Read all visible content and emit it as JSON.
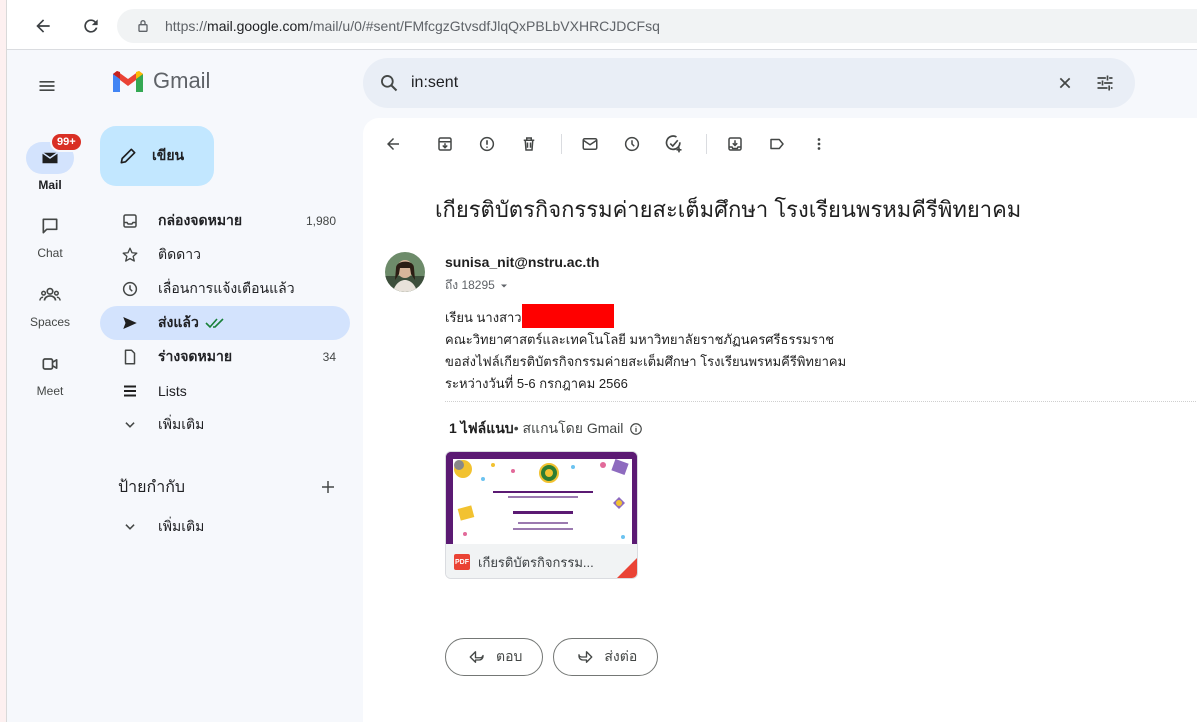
{
  "browser": {
    "url_prefix": "https://",
    "url_host": "mail.google.com",
    "url_path": "/mail/u/0/#sent/FMfcgzGtvsdfJlqQxPBLbVXHRCJDCFsq"
  },
  "app": {
    "name": "Gmail"
  },
  "search": {
    "query": "in:sent"
  },
  "rail": {
    "mail": {
      "label": "Mail",
      "badge": "99+"
    },
    "chat": {
      "label": "Chat"
    },
    "spaces": {
      "label": "Spaces"
    },
    "meet": {
      "label": "Meet"
    }
  },
  "compose": {
    "label": "เขียน"
  },
  "nav": {
    "inbox": {
      "label": "กล่องจดหมาย",
      "count": "1,980"
    },
    "starred": {
      "label": "ติดดาว"
    },
    "snoozed": {
      "label": "เลื่อนการแจ้งเตือนแล้ว"
    },
    "sent": {
      "label": "ส่งแล้ว"
    },
    "drafts": {
      "label": "ร่างจดหมาย",
      "count": "34"
    },
    "lists": {
      "label": "Lists"
    },
    "more": {
      "label": "เพิ่มเติม"
    }
  },
  "labels": {
    "title": "ป้ายกำกับ",
    "more": "เพิ่มเติม"
  },
  "message": {
    "subject": "เกียรติบัตรกิจกรรมค่ายสะเต็มศึกษา โรงเรียนพรหมคีรีพิทยาคม",
    "sender": "sunisa_nit@nstru.ac.th",
    "recipient": "ถึง 18295",
    "body": {
      "line1": "เรียน นางสาว",
      "line2": "คณะวิทยาศาสตร์และเทคโนโลยี มหาวิทยาลัยราชภัฏนครศรีธรรมราช",
      "line3": "ขอส่งไฟล์เกียรติบัตรกิจกรรมค่ายสะเต็มศึกษา โรงเรียนพรหมคีรีพิทยาคม",
      "line4": "ระหว่างวันที่ 5-6 กรกฎาคม 2566"
    },
    "attachments": {
      "count_label": "1 ไฟล์แนบ",
      "scan_label": " • สแกนโดย Gmail",
      "file_name": "เกียรติบัตรกิจกรรม...",
      "file_type": "PDF"
    },
    "actions": {
      "reply": "ตอบ",
      "forward": "ส่งต่อ"
    }
  },
  "colors": {
    "accent": "#0b57d0",
    "badge": "#d93025",
    "sent_check": "#188038",
    "certificate_border": "#5b1a73"
  }
}
